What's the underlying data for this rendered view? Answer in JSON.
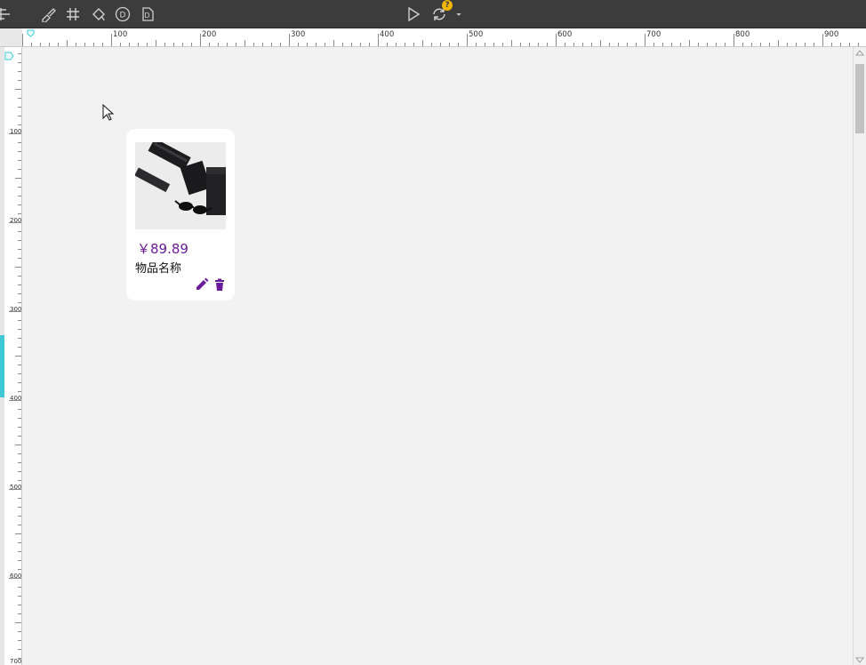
{
  "toolbar": {
    "left_icons": [
      "align-icon",
      "brush-icon",
      "grid-icon",
      "fill-icon",
      "d-circle-icon",
      "d-page-icon"
    ],
    "center_icons": [
      "play-icon",
      "sync-icon",
      "dropdown-arrow-icon"
    ],
    "help_badge": "?"
  },
  "ruler": {
    "top_labels": [
      "100",
      "200",
      "300",
      "400",
      "500",
      "600",
      "700",
      "800",
      "900"
    ],
    "left_labels": [
      "100",
      "200",
      "300",
      "400",
      "500",
      "600",
      "700"
    ]
  },
  "card": {
    "price": "￥89.89",
    "name": "物品名称",
    "image_icon": "sunglasses-case-photo",
    "actions": [
      "edit-icon",
      "delete-icon"
    ]
  },
  "colors": {
    "accent": "#6a1b9a",
    "toolbar_bg": "#3c3c3c",
    "canvas_bg": "#f2f2f2",
    "ruler_marker": "#3fc7d8",
    "badge": "#f2b600"
  }
}
